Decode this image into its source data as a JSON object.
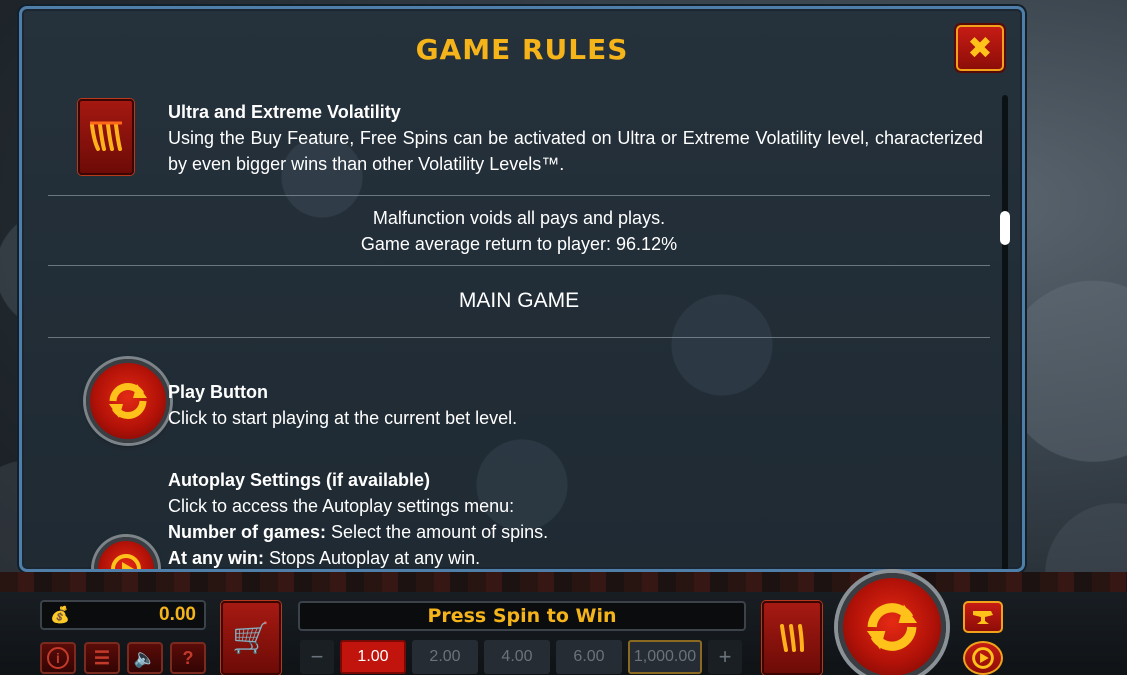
{
  "dialog": {
    "title": "GAME RULES",
    "close_icon": "close-icon"
  },
  "rules": {
    "volatility": {
      "heading": "Ultra and Extreme Volatility",
      "text": "Using the Buy Feature, Free Spins can be activated on Ultra or Extreme Volatility level, characterized by even bigger wins than other Volatility Levels™."
    },
    "malfunction_line": "Malfunction voids all pays and plays.",
    "rtp_line": "Game average return to player: 96.12%",
    "main_game_title": "MAIN GAME",
    "play_button": {
      "heading": "Play Button",
      "text": "Click to start playing at the current bet level."
    },
    "autoplay": {
      "heading": "Autoplay Settings (if available)",
      "text": "Click to access the Autoplay settings menu:",
      "games_label": "Number of games:",
      "games_text": " Select the amount of spins.",
      "anywin_label": "At any win:",
      "anywin_text": " Stops Autoplay at any win."
    }
  },
  "bottom_bar": {
    "balance": "0.00",
    "message": "Press Spin to Win",
    "info_label": "i",
    "help_label": "?",
    "minus_label": "−",
    "plus_label": "+",
    "bets": [
      "1.00",
      "2.00",
      "4.00",
      "6.00",
      "1,000.00"
    ],
    "selected_bet": "1.00"
  },
  "colors": {
    "accent_gold": "#f5b41a",
    "button_red": "#c0140c",
    "panel_border": "#4f7fa8"
  }
}
